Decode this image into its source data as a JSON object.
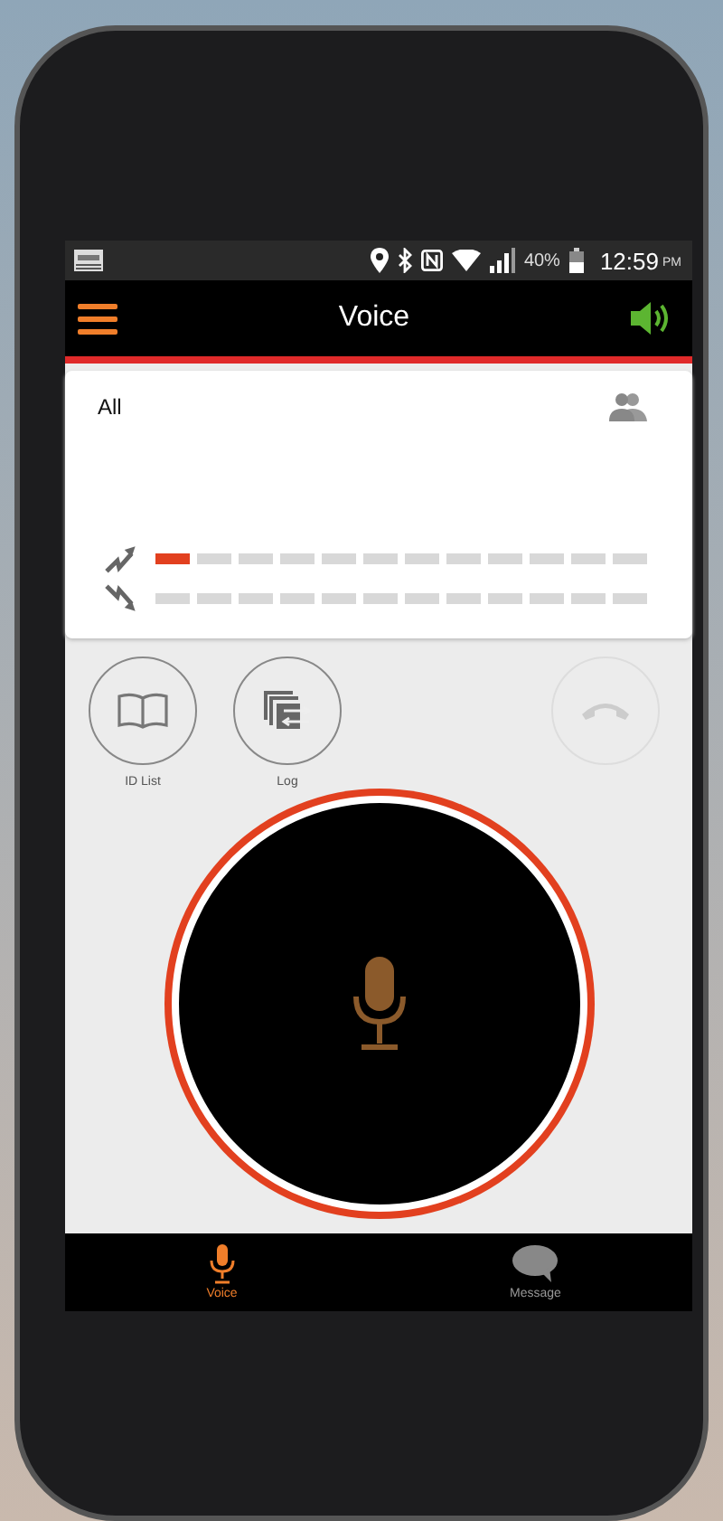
{
  "status_bar": {
    "battery": "40%",
    "time": "12:59",
    "time_suffix": "PM"
  },
  "header": {
    "title": "Voice"
  },
  "channel": {
    "name": "All"
  },
  "meters": [
    {
      "kind": "uplink",
      "level": 0.08
    },
    {
      "kind": "downlink",
      "level": 0
    }
  ],
  "actions": [
    {
      "kind": "id_list",
      "label": "ID List"
    },
    {
      "kind": "log",
      "label": "Log"
    }
  ],
  "hangup": {
    "disabled": true
  },
  "tabs": [
    {
      "kind": "voice",
      "label": "Voice",
      "selected": true
    },
    {
      "kind": "message",
      "label": "Message",
      "selected": false
    }
  ]
}
